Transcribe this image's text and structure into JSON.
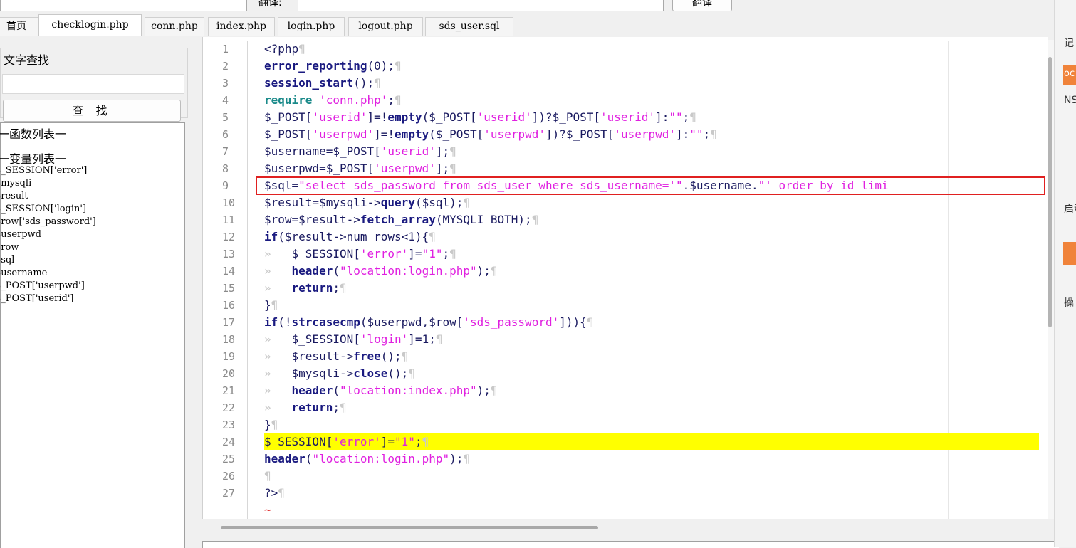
{
  "topbar": {
    "translate_label": "翻译:",
    "translate_button": "翻译"
  },
  "tabs": [
    "首页",
    "checklogin.php",
    "conn.php",
    "index.php",
    "login.php",
    "logout.php",
    "sds_user.sql"
  ],
  "active_tab": 1,
  "left": {
    "search_group_title": "文字查找",
    "search_button": "查 找",
    "functions_header": "一函数列表一",
    "variables_header": "一变量列表一",
    "variables": [
      "$_SESSION['error']",
      "$mysqli",
      "$result",
      "$_SESSION['login']",
      "$row['sds_password']",
      "$userpwd",
      "$row",
      "$sql",
      "$username",
      "$_POST['userpwd']",
      "$_POST['userid']"
    ]
  },
  "editor": {
    "line_numbers": [
      "1",
      "2",
      "3",
      "4",
      "5",
      "6",
      "7",
      "8",
      "9",
      "10",
      "11",
      "12",
      "13",
      "14",
      "15",
      "16",
      "17",
      "18",
      "19",
      "20",
      "21",
      "22",
      "23",
      "24",
      "25",
      "26",
      "27"
    ],
    "highlighted_line": 24,
    "boxed_line": 9,
    "pilcrow": "¶",
    "tab_mark": "»",
    "eof_mark": "~",
    "lines": [
      [
        [
          "op",
          "<?php"
        ]
      ],
      [
        [
          "kw",
          "error_reporting"
        ],
        [
          "op",
          "(0);"
        ]
      ],
      [
        [
          "kw",
          "session_start"
        ],
        [
          "op",
          "();"
        ]
      ],
      [
        [
          "req",
          "require "
        ],
        [
          "str",
          "'conn.php'"
        ],
        [
          "op",
          ";"
        ]
      ],
      [
        [
          "var",
          "$_POST["
        ],
        [
          "str",
          "'userid'"
        ],
        [
          "var",
          "]=!"
        ],
        [
          "kw",
          "empty"
        ],
        [
          "var",
          "($_POST["
        ],
        [
          "str",
          "'userid'"
        ],
        [
          "var",
          "])?$_POST["
        ],
        [
          "str",
          "'userid'"
        ],
        [
          "var",
          "]:"
        ],
        [
          "str",
          "\"\""
        ],
        [
          "op",
          ";"
        ]
      ],
      [
        [
          "var",
          "$_POST["
        ],
        [
          "str",
          "'userpwd'"
        ],
        [
          "var",
          "]=!"
        ],
        [
          "kw",
          "empty"
        ],
        [
          "var",
          "($_POST["
        ],
        [
          "str",
          "'userpwd'"
        ],
        [
          "var",
          "])?$_POST["
        ],
        [
          "str",
          "'userpwd'"
        ],
        [
          "var",
          "]:"
        ],
        [
          "str",
          "\"\""
        ],
        [
          "op",
          ";"
        ]
      ],
      [
        [
          "var",
          "$username=$_POST["
        ],
        [
          "str",
          "'userid'"
        ],
        [
          "var",
          "];"
        ]
      ],
      [
        [
          "var",
          "$userpwd=$_POST["
        ],
        [
          "str",
          "'userpwd'"
        ],
        [
          "var",
          "];"
        ]
      ],
      [
        [
          "var",
          "$sql="
        ],
        [
          "str",
          "\"select sds_password from sds_user where sds_username='\""
        ],
        [
          "var",
          ".$username."
        ],
        [
          "str",
          "\"' order by id limi"
        ]
      ],
      [
        [
          "var",
          "$result=$mysqli->"
        ],
        [
          "kw",
          "query"
        ],
        [
          "var",
          "($sql);"
        ]
      ],
      [
        [
          "var",
          "$row=$result->"
        ],
        [
          "kw",
          "fetch_array"
        ],
        [
          "var",
          "(MYSQLI_BOTH);"
        ]
      ],
      [
        [
          "kw",
          "if"
        ],
        [
          "var",
          "($result->num_rows<1){"
        ]
      ],
      [
        [
          "tab",
          "»   "
        ],
        [
          "var",
          "$_SESSION["
        ],
        [
          "str",
          "'error'"
        ],
        [
          "var",
          "]="
        ],
        [
          "str",
          "\"1\""
        ],
        [
          "op",
          ";"
        ]
      ],
      [
        [
          "tab",
          "»   "
        ],
        [
          "kw",
          "header"
        ],
        [
          "var",
          "("
        ],
        [
          "str",
          "\"location:login.php\""
        ],
        [
          "var",
          ");"
        ]
      ],
      [
        [
          "tab",
          "»   "
        ],
        [
          "kw",
          "return"
        ],
        [
          "var",
          ";"
        ]
      ],
      [
        [
          "var",
          "}"
        ]
      ],
      [
        [
          "kw",
          "if"
        ],
        [
          "var",
          "(!"
        ],
        [
          "kw",
          "strcasecmp"
        ],
        [
          "var",
          "($userpwd,$row["
        ],
        [
          "str",
          "'sds_password'"
        ],
        [
          "var",
          "])){"
        ]
      ],
      [
        [
          "tab",
          "»   "
        ],
        [
          "var",
          "$_SESSION["
        ],
        [
          "str",
          "'login'"
        ],
        [
          "var",
          "]=1;"
        ]
      ],
      [
        [
          "tab",
          "»   "
        ],
        [
          "var",
          "$result->"
        ],
        [
          "kw",
          "free"
        ],
        [
          "var",
          "();"
        ]
      ],
      [
        [
          "tab",
          "»   "
        ],
        [
          "var",
          "$mysqli->"
        ],
        [
          "kw",
          "close"
        ],
        [
          "var",
          "();"
        ]
      ],
      [
        [
          "tab",
          "»   "
        ],
        [
          "kw",
          "header"
        ],
        [
          "var",
          "("
        ],
        [
          "str",
          "\"location:index.php\""
        ],
        [
          "var",
          ");"
        ]
      ],
      [
        [
          "tab",
          "»   "
        ],
        [
          "kw",
          "return"
        ],
        [
          "var",
          ";"
        ]
      ],
      [
        [
          "var",
          "}"
        ]
      ],
      [
        [
          "var",
          "$_SESSION["
        ],
        [
          "str",
          "'error'"
        ],
        [
          "var",
          "]="
        ],
        [
          "str",
          "\"1\""
        ],
        [
          "op",
          ";"
        ]
      ],
      [
        [
          "kw",
          "header"
        ],
        [
          "var",
          "("
        ],
        [
          "str",
          "\"location:login.php\""
        ],
        [
          "var",
          ");"
        ]
      ],
      [],
      [
        [
          "op",
          "?>"
        ]
      ]
    ]
  },
  "right_strip": [
    "记",
    "oc",
    "NS",
    "启动",
    "操"
  ]
}
